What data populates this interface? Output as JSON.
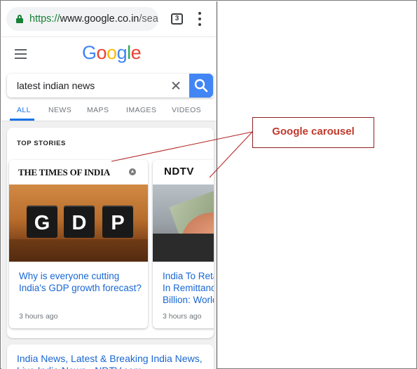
{
  "browser": {
    "url_scheme": "https://",
    "url_host": "www.google.co.in",
    "url_rest": "/sea",
    "tab_count": "3"
  },
  "google": {
    "logo_letters": [
      "G",
      "o",
      "o",
      "g",
      "l",
      "e"
    ],
    "logo_colors": [
      "#4285f4",
      "#ea4335",
      "#fbbc05",
      "#4285f4",
      "#34a853",
      "#ea4335"
    ]
  },
  "search": {
    "query": "latest indian news"
  },
  "nav_tabs": [
    {
      "label": "ALL",
      "active": true
    },
    {
      "label": "NEWS",
      "active": false
    },
    {
      "label": "MAPS",
      "active": false
    },
    {
      "label": "IMAGES",
      "active": false
    },
    {
      "label": "VIDEOS",
      "active": false
    }
  ],
  "top_stories": {
    "title": "TOP STORIES",
    "stories": [
      {
        "source": "THE TIMES OF INDIA",
        "image_letters": [
          "G",
          "D",
          "P"
        ],
        "headline": "Why is everyone cutting India's GDP growth forecast?",
        "time": "3 hours ago"
      },
      {
        "source": "NDTV",
        "headline": "India To Reta In Remittance Billion: World",
        "time": "3 hours ago"
      }
    ]
  },
  "result": {
    "title": "India News, Latest & Breaking India News, Live India News - NDTV.com"
  },
  "annotation": {
    "label": "Google carousel",
    "color": "#c0392b"
  },
  "colors": {
    "accent": "#1a73e8",
    "link": "#1967d2",
    "search_button": "#4285f4",
    "secure": "#188038"
  }
}
